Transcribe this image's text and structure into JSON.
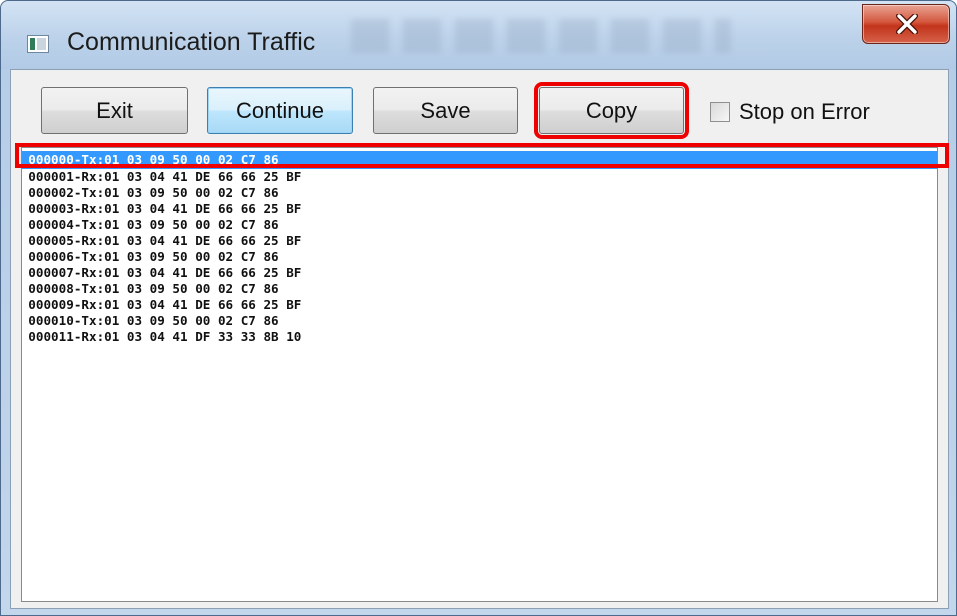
{
  "window": {
    "title": "Communication Traffic",
    "accent": "#3399ff",
    "annotation_color": "#ee0000"
  },
  "toolbar": {
    "exit_label": "Exit",
    "continue_label": "Continue",
    "save_label": "Save",
    "copy_label": "Copy",
    "stop_on_error_label": "Stop on Error",
    "stop_on_error_checked": false
  },
  "log": {
    "selected_index": 0,
    "lines": [
      "000000-Tx:01 03 09 50 00 02 C7 86",
      "000001-Rx:01 03 04 41 DE 66 66 25 BF",
      "000002-Tx:01 03 09 50 00 02 C7 86",
      "000003-Rx:01 03 04 41 DE 66 66 25 BF",
      "000004-Tx:01 03 09 50 00 02 C7 86",
      "000005-Rx:01 03 04 41 DE 66 66 25 BF",
      "000006-Tx:01 03 09 50 00 02 C7 86",
      "000007-Rx:01 03 04 41 DE 66 66 25 BF",
      "000008-Tx:01 03 09 50 00 02 C7 86",
      "000009-Rx:01 03 04 41 DE 66 66 25 BF",
      "000010-Tx:01 03 09 50 00 02 C7 86",
      "000011-Rx:01 03 04 41 DF 33 33 8B 10"
    ]
  },
  "icons": {
    "app": "app-window-icon",
    "close": "close-icon"
  }
}
